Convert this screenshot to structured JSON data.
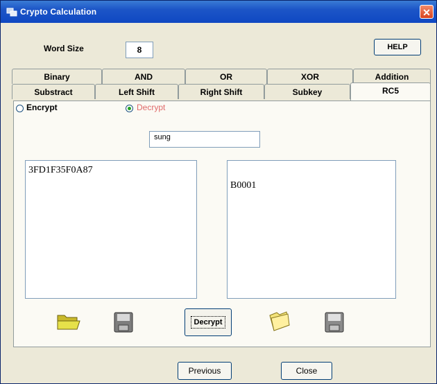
{
  "window": {
    "title": "Crypto Calculation"
  },
  "header": {
    "word_size_label": "Word Size",
    "word_size_value": "8",
    "help_label": "HELP"
  },
  "tabs_row1": [
    "Binary",
    "AND",
    "OR",
    "XOR",
    "Addition"
  ],
  "tabs_row2": [
    "Substract",
    "Left Shift",
    "Right Shift",
    "Subkey",
    "RC5"
  ],
  "mode": {
    "encrypt_label": "Encrypt",
    "decrypt_label": "Decrypt",
    "selected": "Decrypt",
    "decrypt_color": "#e06a6a"
  },
  "key_input": {
    "value": "sung"
  },
  "input_text": "3FD1F35F0A87",
  "output_text": "B0001",
  "action_button": "Decrypt",
  "icons": [
    "folder-open-icon",
    "save-disk-icon",
    "folder-open-icon",
    "save-disk-icon"
  ],
  "footer": {
    "previous_label": "Previous",
    "close_label": "Close"
  }
}
